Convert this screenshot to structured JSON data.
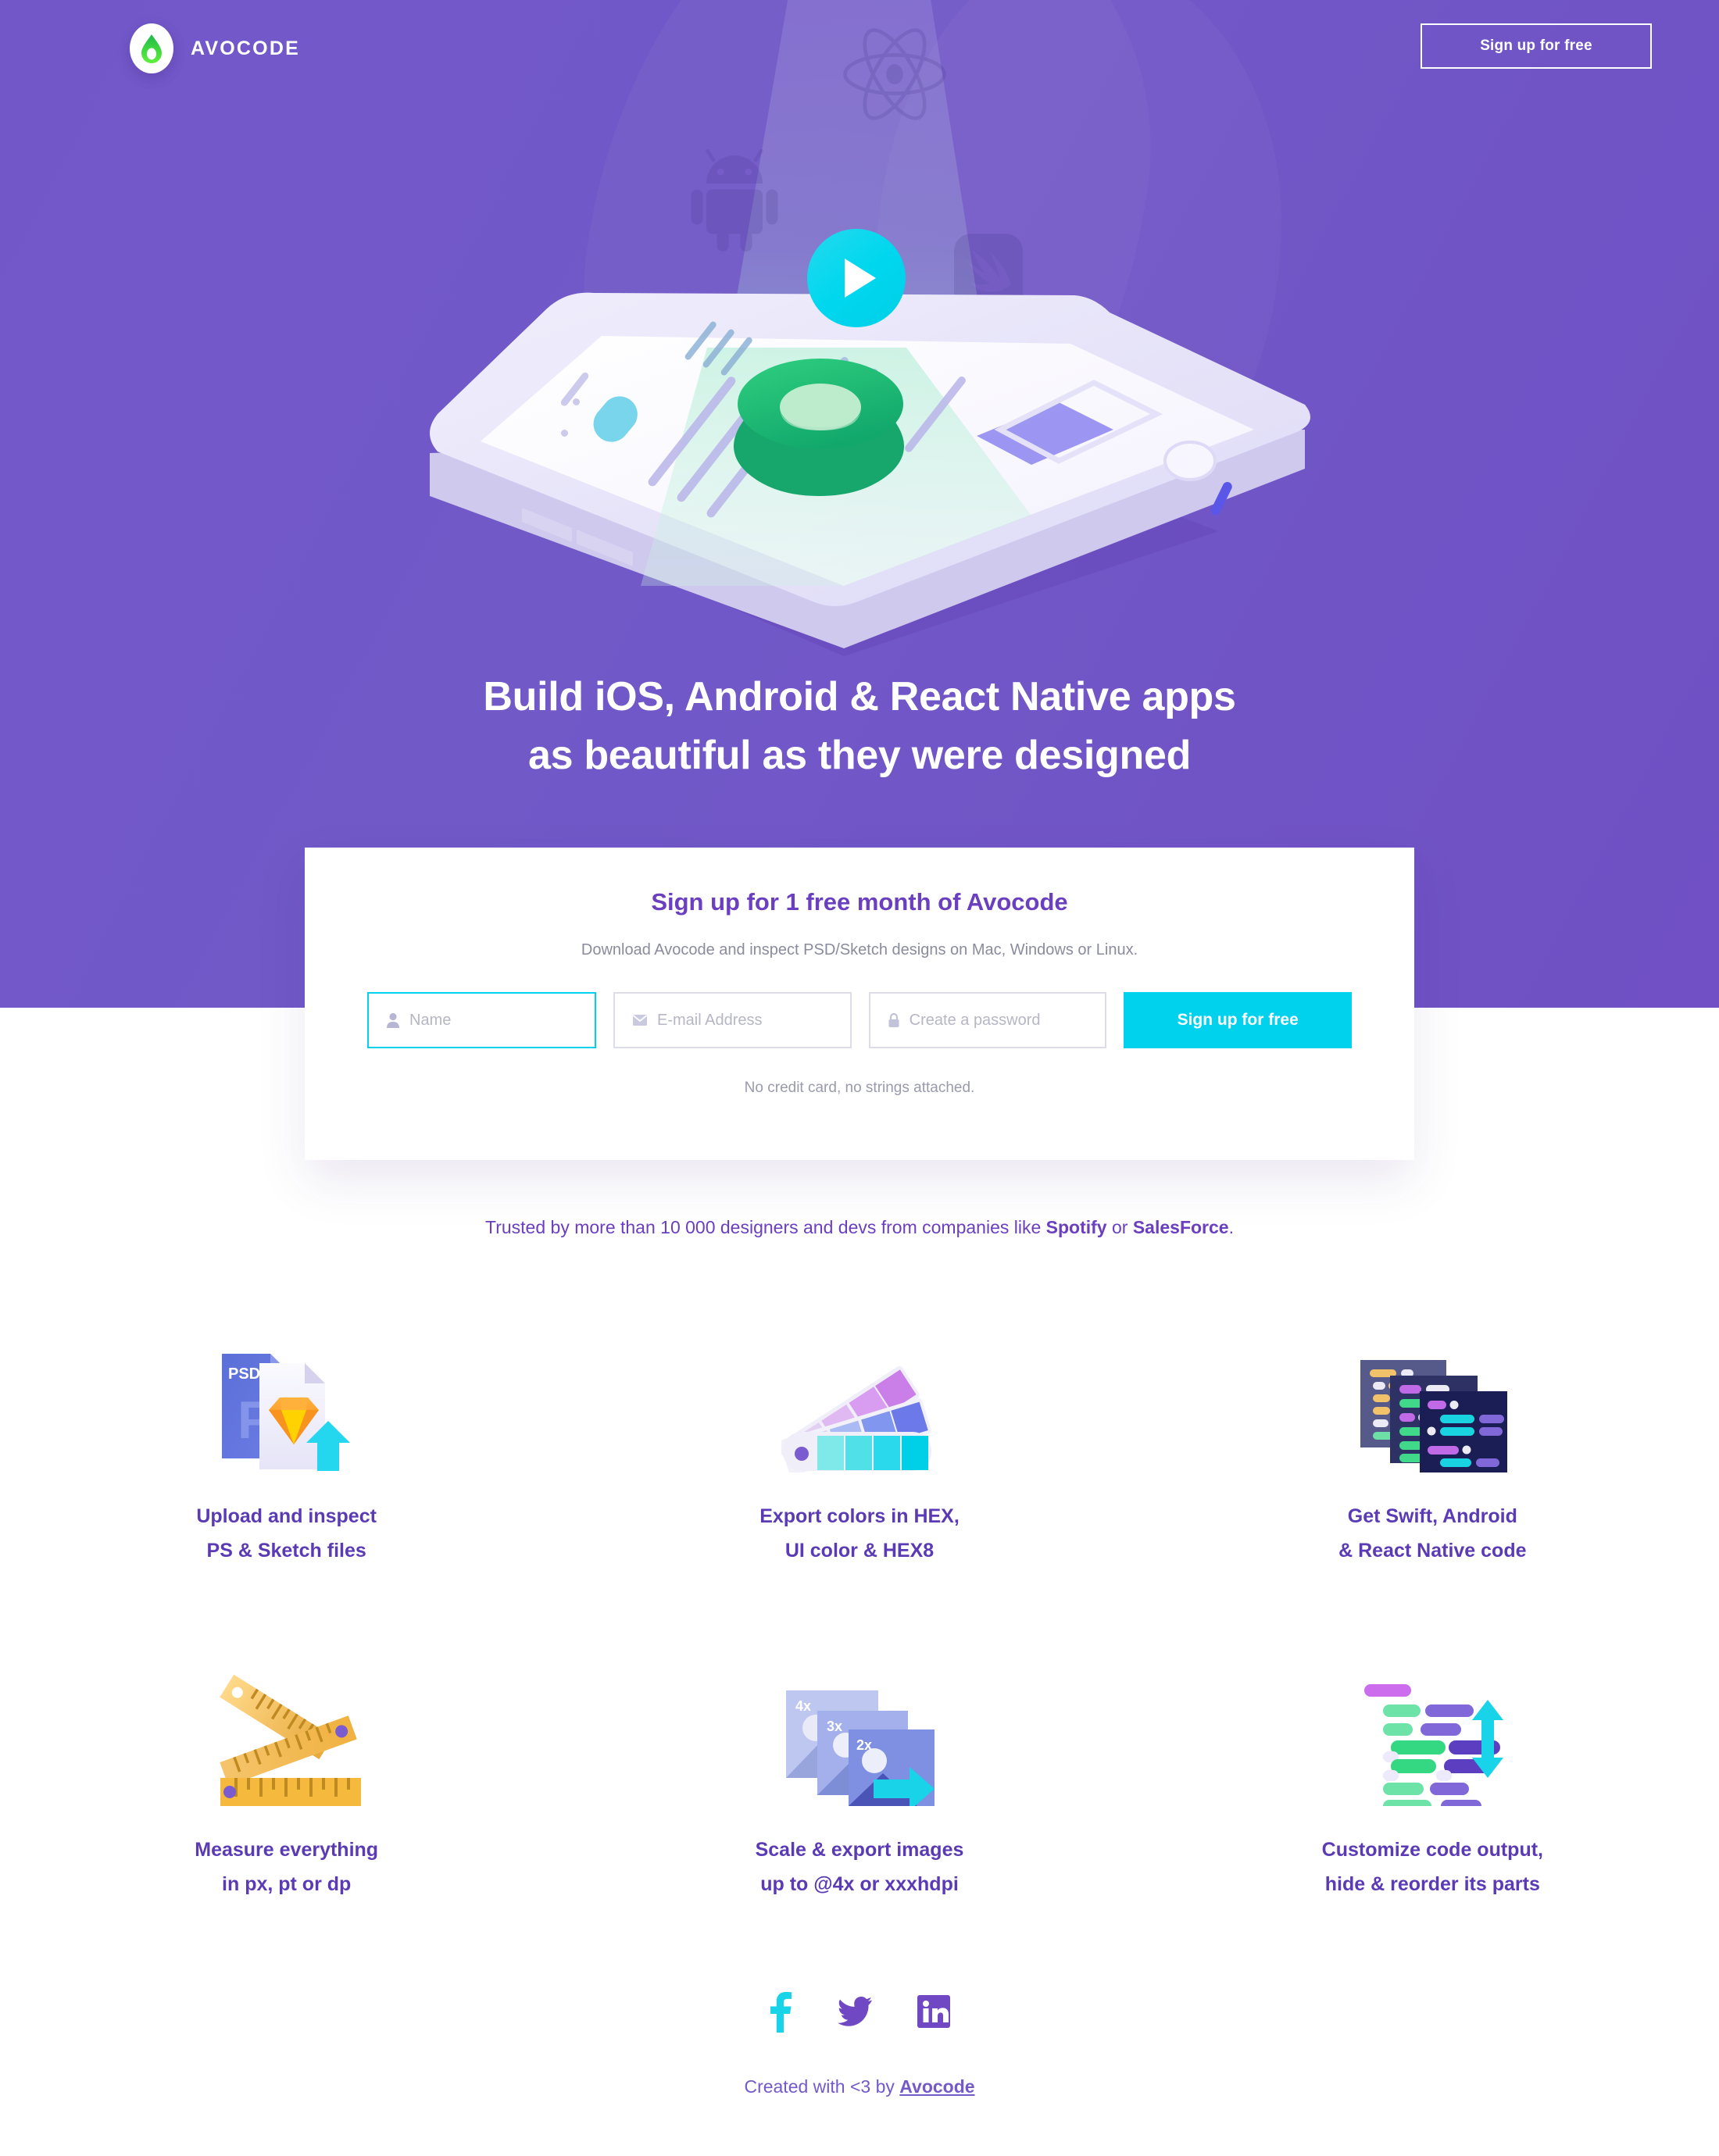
{
  "brand": {
    "name": "AVOCODE",
    "logo_icon": "avocado-drop-icon"
  },
  "header": {
    "signup_label": "Sign up for free"
  },
  "hero": {
    "play_icon": "play-icon",
    "tech_icons": [
      "react-icon",
      "android-icon",
      "swift-icon"
    ],
    "headline_line1": "Build iOS, Android & React Native apps",
    "headline_line2": "as beautiful as they were designed"
  },
  "signup_card": {
    "title": "Sign up for 1 free month of Avocode",
    "subtitle": "Download Avocode and inspect PSD/Sketch designs on Mac, Windows or Linux.",
    "fields": [
      {
        "name": "name",
        "icon": "user-icon",
        "placeholder": "Name",
        "value": ""
      },
      {
        "name": "email",
        "icon": "mail-icon",
        "placeholder": "E-mail Address",
        "value": ""
      },
      {
        "name": "password",
        "icon": "lock-icon",
        "placeholder": "Create a password",
        "value": ""
      }
    ],
    "submit_label": "Sign up for free",
    "note": "No credit card, no strings attached."
  },
  "trust": {
    "prefix": "Trusted by more than 10 000 designers and devs from companies like ",
    "company1": "Spotify",
    "middle": " or ",
    "company2": "SalesForce",
    "suffix": "."
  },
  "features": [
    {
      "icon": "psd-sketch-upload-icon",
      "line1": "Upload and inspect",
      "line2": "PS & Sketch files"
    },
    {
      "icon": "color-swatches-icon",
      "line1": "Export colors in HEX,",
      "line2": "UI color & HEX8"
    },
    {
      "icon": "code-windows-icon",
      "line1": "Get Swift, Android",
      "line2": "& React Native code"
    },
    {
      "icon": "folding-ruler-icon",
      "line1": "Measure everything",
      "line2": "in px, pt or dp"
    },
    {
      "icon": "image-scale-icon",
      "line1": "Scale & export images",
      "line2": "up to @4x or xxxhdpi"
    },
    {
      "icon": "code-reorder-icon",
      "line1": "Customize code output,",
      "line2": "hide & reorder its parts"
    }
  ],
  "scale_labels": [
    "4x",
    "3x",
    "2x"
  ],
  "psd_label": "PSD",
  "footer": {
    "socials": [
      {
        "name": "facebook-icon",
        "label": "Facebook"
      },
      {
        "name": "twitter-icon",
        "label": "Twitter"
      },
      {
        "name": "linkedin-icon",
        "label": "LinkedIn"
      }
    ],
    "text_prefix": "Created with <3 by ",
    "link_label": "Avocode"
  },
  "colors": {
    "purple_bg": "#7257c9",
    "accent_cyan": "#00d2ee",
    "heading_purple": "#6a3fc0",
    "feature_purple": "#5b3bb5",
    "logo_green": "#3ddb3d"
  }
}
